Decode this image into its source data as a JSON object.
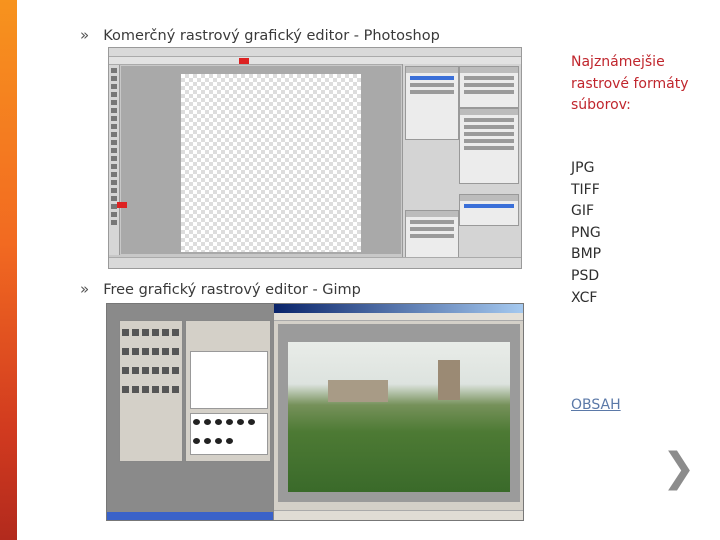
{
  "bullets": [
    {
      "marker": "»",
      "text": "Komerčný rastrový grafický editor - Photoshop"
    },
    {
      "marker": "»",
      "text": "Free grafický rastrový editor - Gimp"
    }
  ],
  "side": {
    "title": "Najznámejšie rastrové formáty súborov:",
    "formats": [
      "JPG",
      "TIFF",
      "GIF",
      "PNG",
      "BMP",
      "PSD",
      "XCF"
    ],
    "link": "OBSAH",
    "next_arrow": "❯"
  },
  "screenshots": {
    "photoshop": {
      "icon": "photoshop-screenshot"
    },
    "gimp": {
      "icon": "gimp-screenshot"
    }
  },
  "colors": {
    "accent_bar": "#f26a21",
    "title": "#c0262d",
    "link": "#5b79a8"
  }
}
